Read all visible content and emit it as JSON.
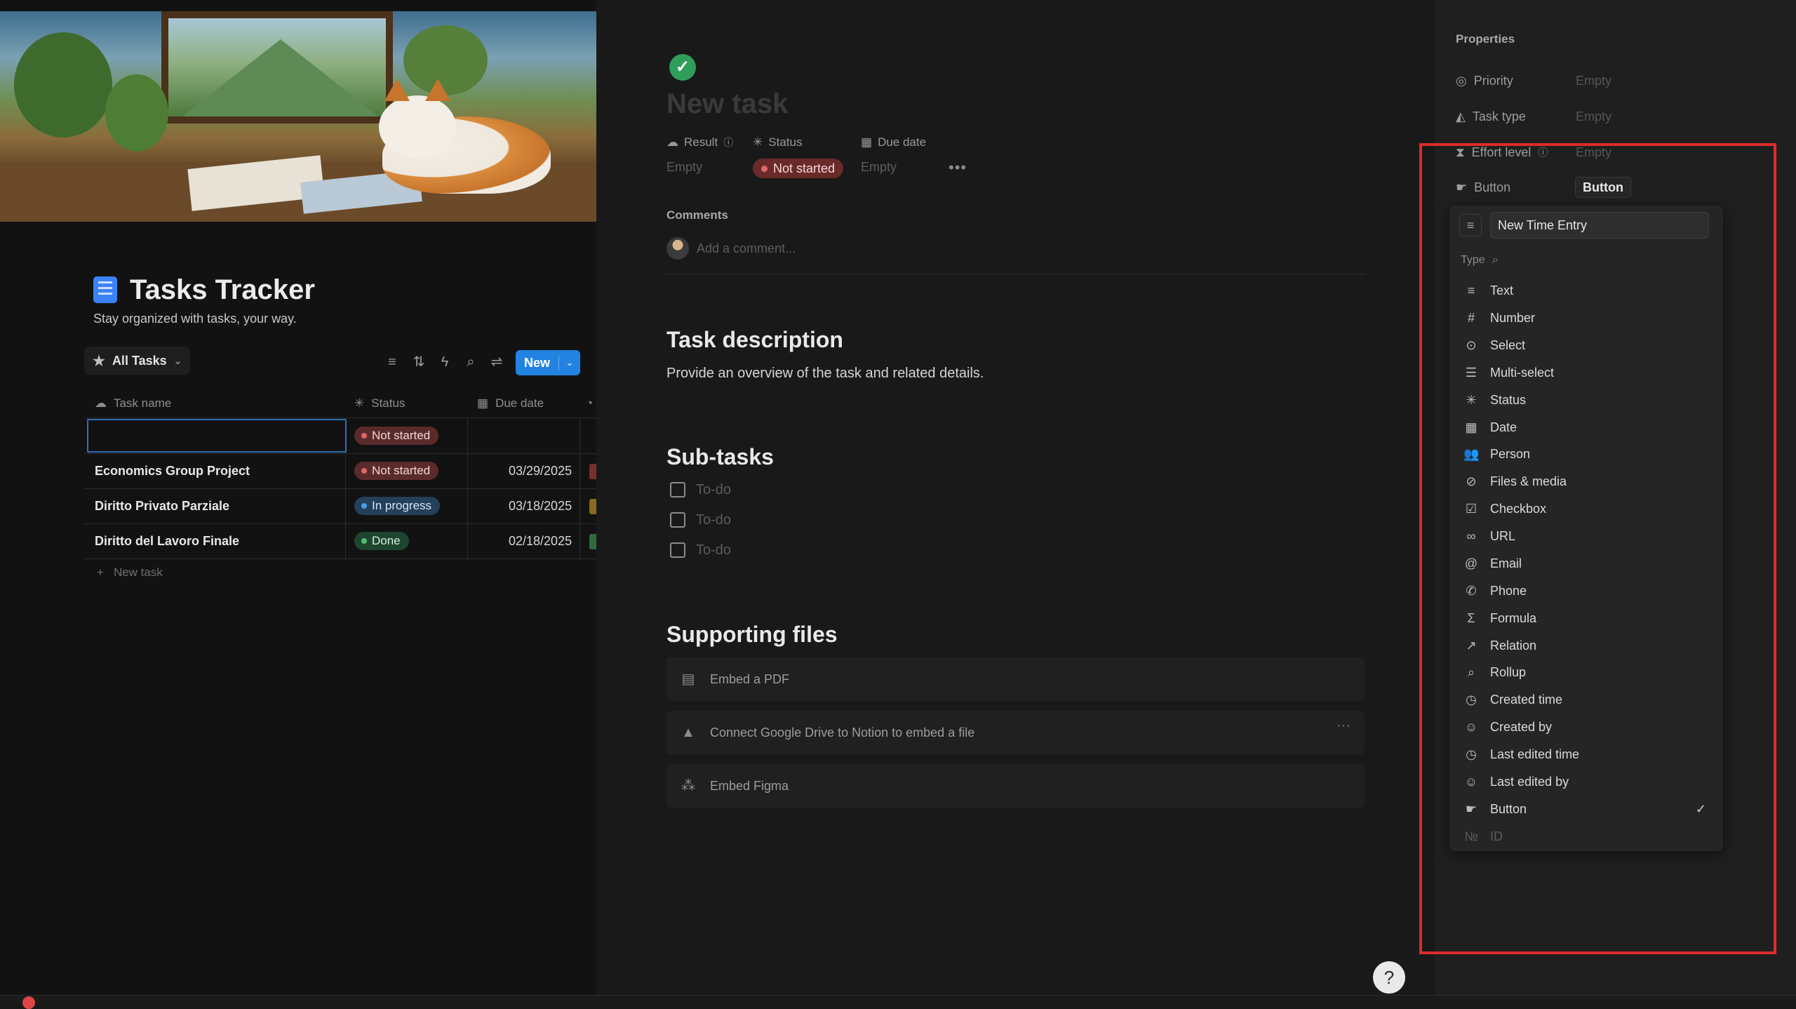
{
  "colors": {
    "accent": "#2383e2",
    "not_started": "#e06464",
    "in_progress": "#4a9eec",
    "done": "#4fbf74",
    "highlight_box": "#e02a2a"
  },
  "tracker": {
    "title": "Tasks Tracker",
    "subtitle": "Stay organized with tasks, your way.",
    "view_tab": "All Tasks",
    "new_button": "New",
    "columns": {
      "name": "Task name",
      "status": "Status",
      "due": "Due date"
    },
    "rows": [
      {
        "name": "",
        "status": "Not started",
        "due": ""
      },
      {
        "name": "Economics Group Project",
        "status": "Not started",
        "due": "03/29/2025"
      },
      {
        "name": "Diritto Privato Parziale",
        "status": "In progress",
        "due": "03/18/2025"
      },
      {
        "name": "Diritto del Lavoro Finale",
        "status": "Done",
        "due": "02/18/2025"
      }
    ],
    "new_task": "New task"
  },
  "task": {
    "title": "New task",
    "props": {
      "result_label": "Result",
      "result_value": "Empty",
      "status_label": "Status",
      "status_value": "Not started",
      "due_label": "Due date",
      "due_value": "Empty"
    },
    "comments_label": "Comments",
    "comment_placeholder": "Add a comment...",
    "description_heading": "Task description",
    "description_text": "Provide an overview of the task and related details.",
    "subtasks_heading": "Sub-tasks",
    "subtasks": [
      "To-do",
      "To-do",
      "To-do"
    ],
    "files_heading": "Supporting files",
    "files": [
      "Embed a PDF",
      "Connect Google Drive to Notion to embed a file",
      "Embed Figma"
    ]
  },
  "properties_panel": {
    "title": "Properties",
    "items": [
      {
        "label": "Priority",
        "value": "Empty"
      },
      {
        "label": "Task type",
        "value": "Empty"
      },
      {
        "label": "Effort level",
        "value": "Empty"
      },
      {
        "label": "Button",
        "value": "Button"
      }
    ],
    "menu": {
      "name_value": "New Time Entry",
      "type_label": "Type",
      "types": [
        "Text",
        "Number",
        "Select",
        "Multi-select",
        "Status",
        "Date",
        "Person",
        "Files & media",
        "Checkbox",
        "URL",
        "Email",
        "Phone",
        "Formula",
        "Relation",
        "Rollup",
        "Created time",
        "Created by",
        "Last edited time",
        "Last edited by",
        "Button",
        "ID"
      ],
      "selected_type": "Button"
    }
  }
}
